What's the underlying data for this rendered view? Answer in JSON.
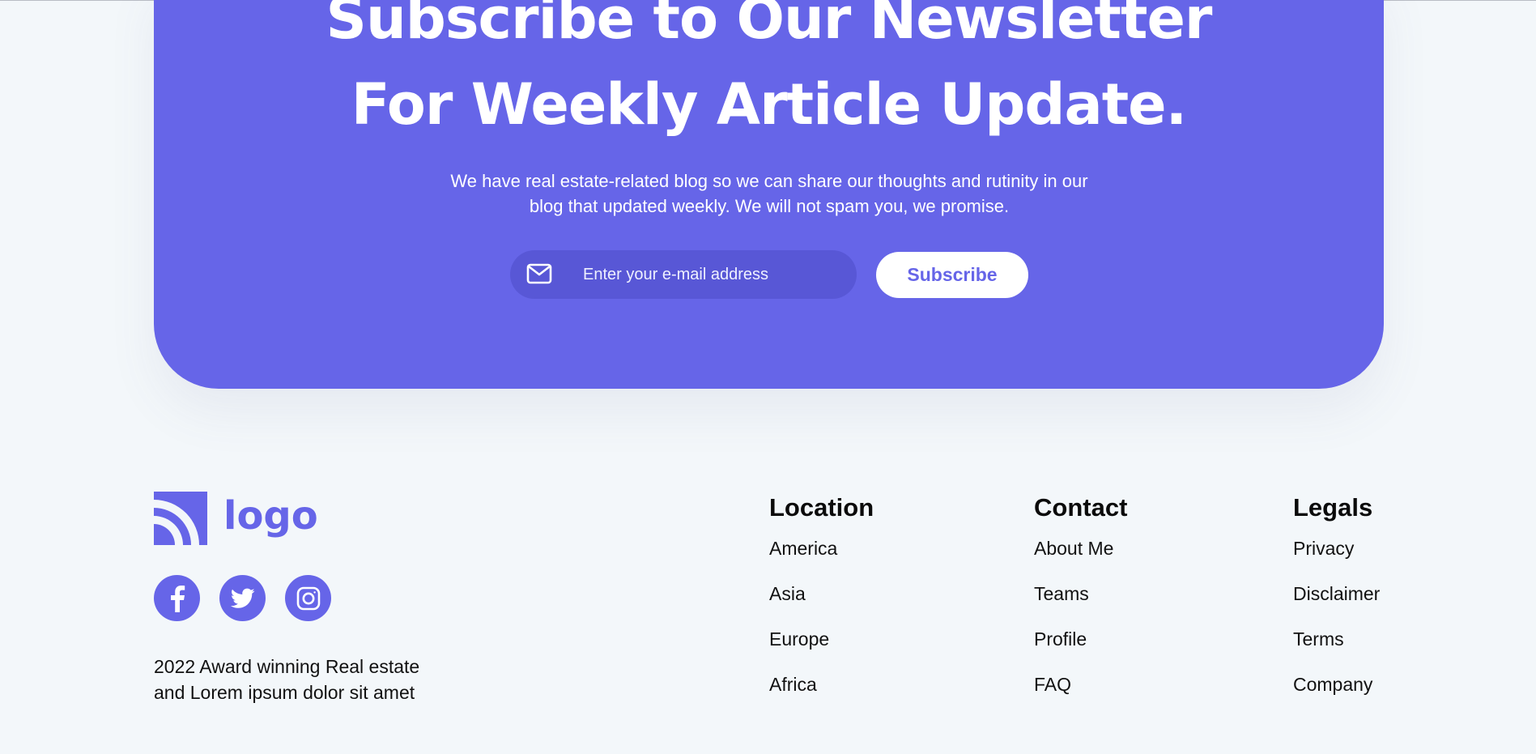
{
  "newsletter": {
    "title_line1": "Subscribe to Our Newsletter",
    "title_line2": "For Weekly Article Update.",
    "description_line1": "We have real estate-related blog so we can share our thoughts and rutinity in our",
    "description_line2": "blog that updated weekly. We will not spam you, we promise.",
    "email_placeholder": "Enter your e-mail address",
    "email_icon": "mail-icon",
    "subscribe_label": "Subscribe"
  },
  "footer": {
    "logo_text": "logo",
    "socials": [
      {
        "name": "facebook",
        "icon": "facebook-icon"
      },
      {
        "name": "twitter",
        "icon": "twitter-icon"
      },
      {
        "name": "instagram",
        "icon": "instagram-icon"
      }
    ],
    "tagline_line1": "2022 Award winning Real estate",
    "tagline_line2": "and Lorem ipsum dolor sit amet",
    "columns": [
      {
        "title": "Location",
        "items": [
          "America",
          "Asia",
          "Europe",
          "Africa"
        ]
      },
      {
        "title": "Contact",
        "items": [
          "About Me",
          "Teams",
          "Profile",
          "FAQ"
        ]
      },
      {
        "title": "Legals",
        "items": [
          "Privacy",
          "Disclaimer",
          "Terms",
          "Company"
        ]
      }
    ]
  },
  "colors": {
    "accent": "#6665E8",
    "input_bg": "#5857D6",
    "page_bg": "#F3F7FA"
  }
}
